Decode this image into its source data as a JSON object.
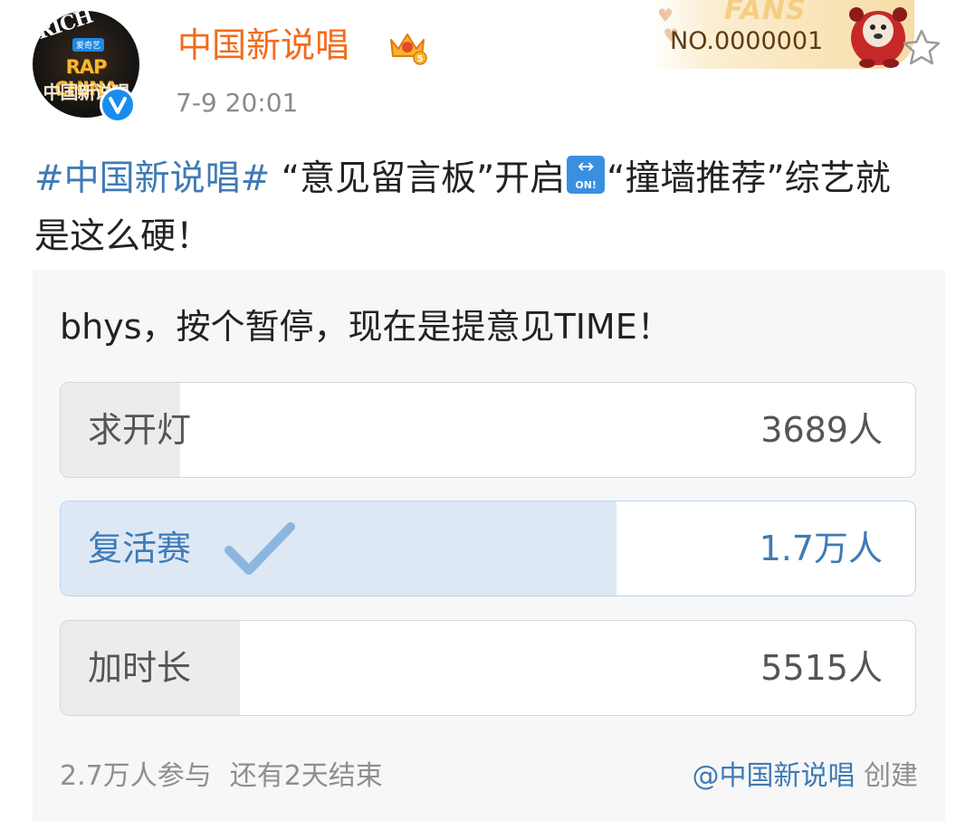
{
  "colors": {
    "accent_blue": "#3f7bb6",
    "username_orange": "#f36b1c",
    "verified_blue": "#1a8cf0"
  },
  "header": {
    "avatar": {
      "icon": "rapchina-avatar",
      "rich_text": "RICH",
      "tag_text": "爱奇艺",
      "logo_line1": "RAP CHINA",
      "logo_line2": "中国新说唱"
    },
    "verified_icon": "verified-v-icon",
    "user_name": "中国新说唱",
    "crown_icon": "crown-level-5-icon",
    "post_time": "7-9 20:01",
    "fans_badge": {
      "label": "FANS",
      "number": "NO.0000001",
      "mascot_icon": "mascot-icon"
    },
    "favorite_icon": "star-outline-icon"
  },
  "post": {
    "hashtag": "#中国新说唱#",
    "text_part1": " “意见留言板”开启",
    "emoji_icon": "on-arrow-emoji",
    "emoji_text": "ON!",
    "text_part2": "“撞墙推荐”综艺就是这么硬！"
  },
  "poll": {
    "question": "bhys，按个暂停，现在是提意见TIME！",
    "options": [
      {
        "label": "求开灯",
        "count": "3689人",
        "share": 0.14,
        "selected": false
      },
      {
        "label": "复活赛",
        "count": "1.7万人",
        "share": 0.65,
        "selected": true
      },
      {
        "label": "加时长",
        "count": "5515人",
        "share": 0.21,
        "selected": false
      }
    ],
    "selected_icon": "checkmark-icon",
    "participants": "2.7万人参与",
    "time_left": "还有2天结束",
    "creator": "@中国新说唱",
    "created_suffix": " 创建"
  }
}
